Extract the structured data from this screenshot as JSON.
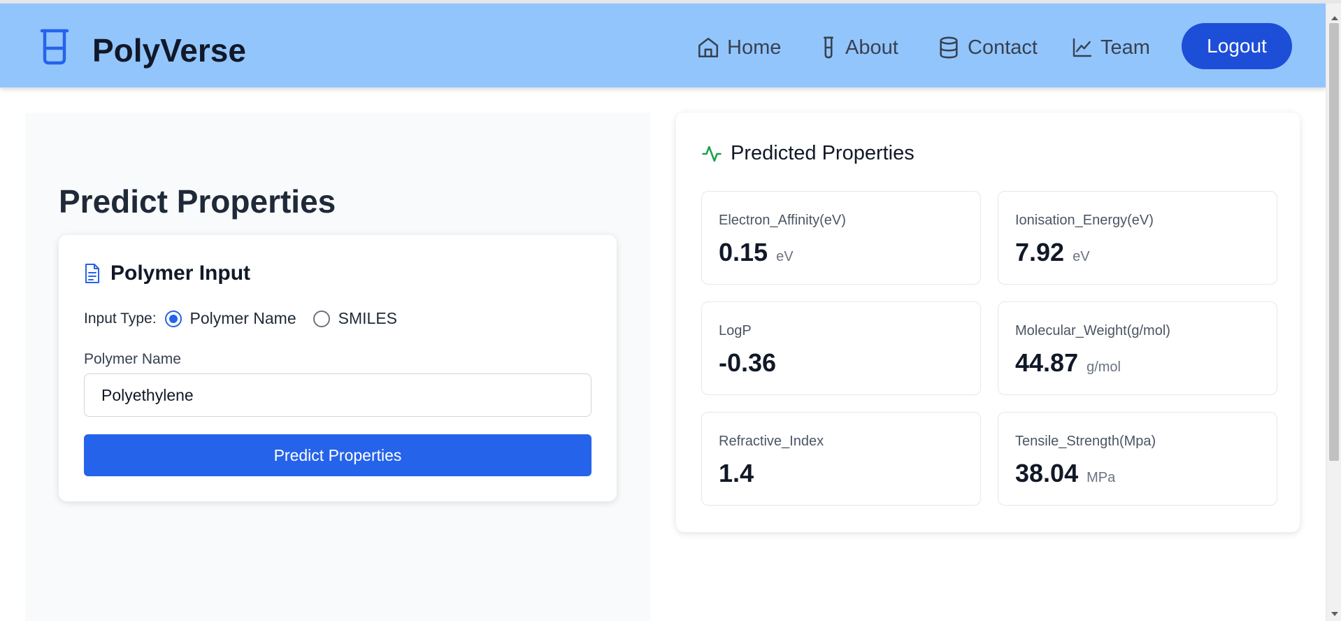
{
  "header": {
    "brand": "PolyVerse",
    "nav": [
      {
        "label": "Home",
        "icon": "home-icon"
      },
      {
        "label": "About",
        "icon": "test-tube-icon"
      },
      {
        "label": "Contact",
        "icon": "database-icon"
      },
      {
        "label": "Team",
        "icon": "line-chart-icon"
      }
    ],
    "logout_label": "Logout",
    "logo_icon": "beaker-icon"
  },
  "main": {
    "page_title": "Predict Properties",
    "input_card": {
      "title": "Polymer Input",
      "title_icon": "document-icon",
      "input_type_label": "Input Type:",
      "options": [
        {
          "label": "Polymer Name",
          "selected": true
        },
        {
          "label": "SMILES",
          "selected": false
        }
      ],
      "field_label": "Polymer Name",
      "field_value": "Polyethylene",
      "submit_label": "Predict Properties"
    },
    "results": {
      "title": "Predicted Properties",
      "title_icon": "activity-icon",
      "properties": [
        {
          "label": "Electron_Affinity(eV)",
          "value": "0.15",
          "unit": "eV"
        },
        {
          "label": "Ionisation_Energy(eV)",
          "value": "7.92",
          "unit": "eV"
        },
        {
          "label": "LogP",
          "value": "-0.36",
          "unit": ""
        },
        {
          "label": "Molecular_Weight(g/mol)",
          "value": "44.87",
          "unit": "g/mol"
        },
        {
          "label": "Refractive_Index",
          "value": "1.4",
          "unit": ""
        },
        {
          "label": "Tensile_Strength(Mpa)",
          "value": "38.04",
          "unit": "MPa"
        }
      ]
    }
  },
  "colors": {
    "header_bg": "#93c5fd",
    "primary": "#2563eb",
    "logout_bg": "#1d4ed8",
    "activity_icon": "#16a34a"
  }
}
